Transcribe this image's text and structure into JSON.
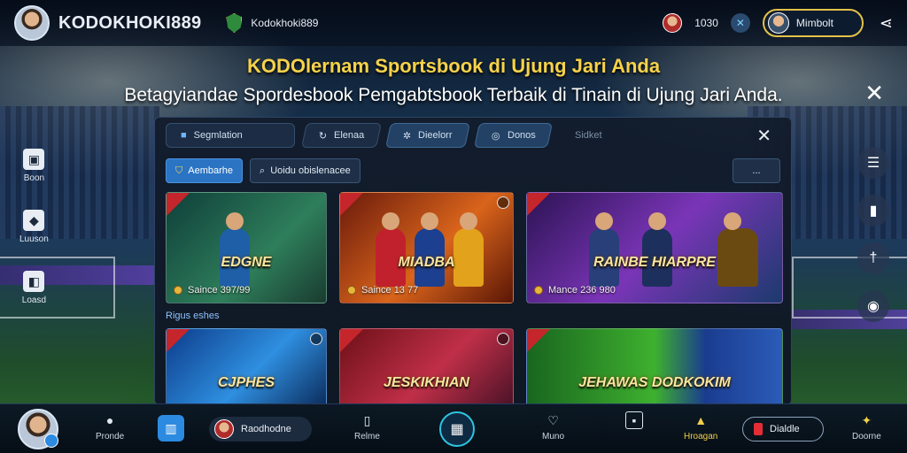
{
  "header": {
    "brand": "KODOKHOKI889",
    "brand_small": "Kodokhoki889",
    "coins": "1030",
    "user_name": "Mimbolt",
    "share_icon": "share-icon"
  },
  "headline": "KODOlernam Sportsbook di Ujung Jari Anda",
  "subheadline": "Betagyiandae Spordesbook Pemgabtsbook Terbaik di Tinain di Ujung Jari Anda.",
  "side_left": [
    {
      "label": "Boon",
      "icon": "box-icon"
    },
    {
      "label": "Luuson",
      "icon": "puzzle-icon"
    },
    {
      "label": "Loasd",
      "icon": "cube-icon"
    }
  ],
  "side_right": [
    {
      "icon": "menu-icon"
    },
    {
      "icon": "bag-icon"
    },
    {
      "icon": "pin-icon"
    },
    {
      "icon": "location-icon"
    }
  ],
  "panel": {
    "tabs": [
      {
        "label": "Segmlation",
        "icon": "cube-icon"
      },
      {
        "label": "Elenaa",
        "icon": "refresh-icon"
      },
      {
        "label": "Dieelorr",
        "icon": "gear-icon"
      },
      {
        "label": "Donos",
        "icon": "gift-icon"
      },
      {
        "label": "Sidket",
        "icon": ""
      }
    ],
    "filters": {
      "primary": "Aembarhe",
      "secondary": "Uoidu obislenacee",
      "right": "..."
    },
    "section_label": "Rigus eshes",
    "cards": [
      {
        "title": "EDGNE",
        "meta": "Saince 397/99"
      },
      {
        "title": "MIADBA",
        "meta": "Saince 13 77"
      },
      {
        "title": "RAINBE HIARPRE",
        "meta": "Mance 236 980"
      },
      {
        "title": "CJPHES",
        "meta": ""
      },
      {
        "title": "JESKIKHIAN",
        "meta": ""
      },
      {
        "title": "JEHAWAS DODKOKIM",
        "meta": ""
      }
    ]
  },
  "bottom": {
    "profile_label": "Pronde",
    "pill_label": "Raodhodne",
    "item1_label": "Relme",
    "item2_label": "Muno",
    "item3_label": "",
    "item4_label": "Hroagan",
    "deposit_label": "Dialdle",
    "last_label": "Doorne"
  },
  "colors": {
    "accent": "#2c8be0",
    "headline": "#f6d24a",
    "gold_border": "#e2c24a",
    "deposit_dot": "#e22d36"
  }
}
